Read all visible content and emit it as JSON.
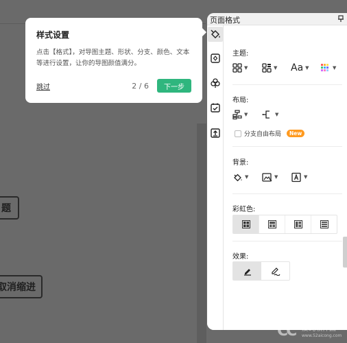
{
  "canvas": {
    "node1_text": "题",
    "node2_text": "取消缩进"
  },
  "tooltip": {
    "title": "样式设置",
    "body": "点击【格式】，对导图主题、形状、分支、颜色、文本等进行设置，让你的导图颜值满分。",
    "skip_label": "跳过",
    "progress": "2 / 6",
    "next_label": "下一步"
  },
  "panel": {
    "title": "页面格式",
    "sections": {
      "theme": "主题:",
      "layout": "布局:",
      "background": "背景:",
      "rainbow": "彩虹色:",
      "effect": "效果:"
    },
    "free_layout_label": "分支自由布局",
    "new_badge": "New",
    "font_icon_text": "Aa"
  },
  "watermark": {
    "logo": "CC",
    "site_cn": "爱纯软件园",
    "url": "www.52aicong.com"
  },
  "colors": {
    "accent_green": "#2fb67e",
    "new_badge": "#ff9a1f",
    "overlay": "#6a6a6a"
  },
  "icons": [
    "paint-bucket-icon",
    "shape-badge-icon",
    "clover-icon",
    "calendar-check-icon",
    "export-icon",
    "pin-icon",
    "grid-layout-icon",
    "grid-alt-icon",
    "font-icon",
    "palette-icon",
    "tree-layout-icon",
    "branch-icon",
    "fill-icon",
    "image-icon",
    "text-box-icon",
    "rainbow-icon",
    "pen-icon",
    "sign-icon"
  ]
}
